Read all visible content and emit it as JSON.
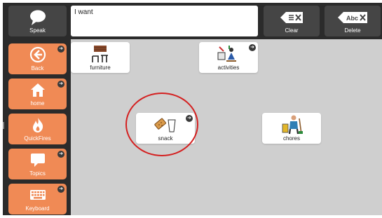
{
  "toolbar": {
    "speak_label": "Speak",
    "clear_label": "Clear",
    "delete_label": "Delete",
    "delete_icon_text": "Abc",
    "clear_icon_text": "≡"
  },
  "message": {
    "text": "I want"
  },
  "sidebar": {
    "items": [
      {
        "label": "Back"
      },
      {
        "label": "home"
      },
      {
        "label": "QuickFires"
      },
      {
        "label": "Topics"
      },
      {
        "label": "Keyboard"
      }
    ]
  },
  "grid": {
    "cells": [
      {
        "label": "furniture"
      },
      {
        "label": "activities"
      },
      {
        "label": "snack"
      },
      {
        "label": "chores"
      }
    ]
  },
  "colors": {
    "accent": "#f08a55",
    "toolbar": "#2b2b2b",
    "grid_bg": "#cfcfcf",
    "highlight_circle": "#d42020"
  },
  "icons": [
    "speech-bubble-icon",
    "clear-icon",
    "delete-icon",
    "back-arrow-icon",
    "home-icon",
    "fire-icon",
    "topics-bubble-icon",
    "keyboard-icon",
    "furniture-icon",
    "activities-icon",
    "snack-icon",
    "chores-icon",
    "folder-indicator-icon"
  ]
}
